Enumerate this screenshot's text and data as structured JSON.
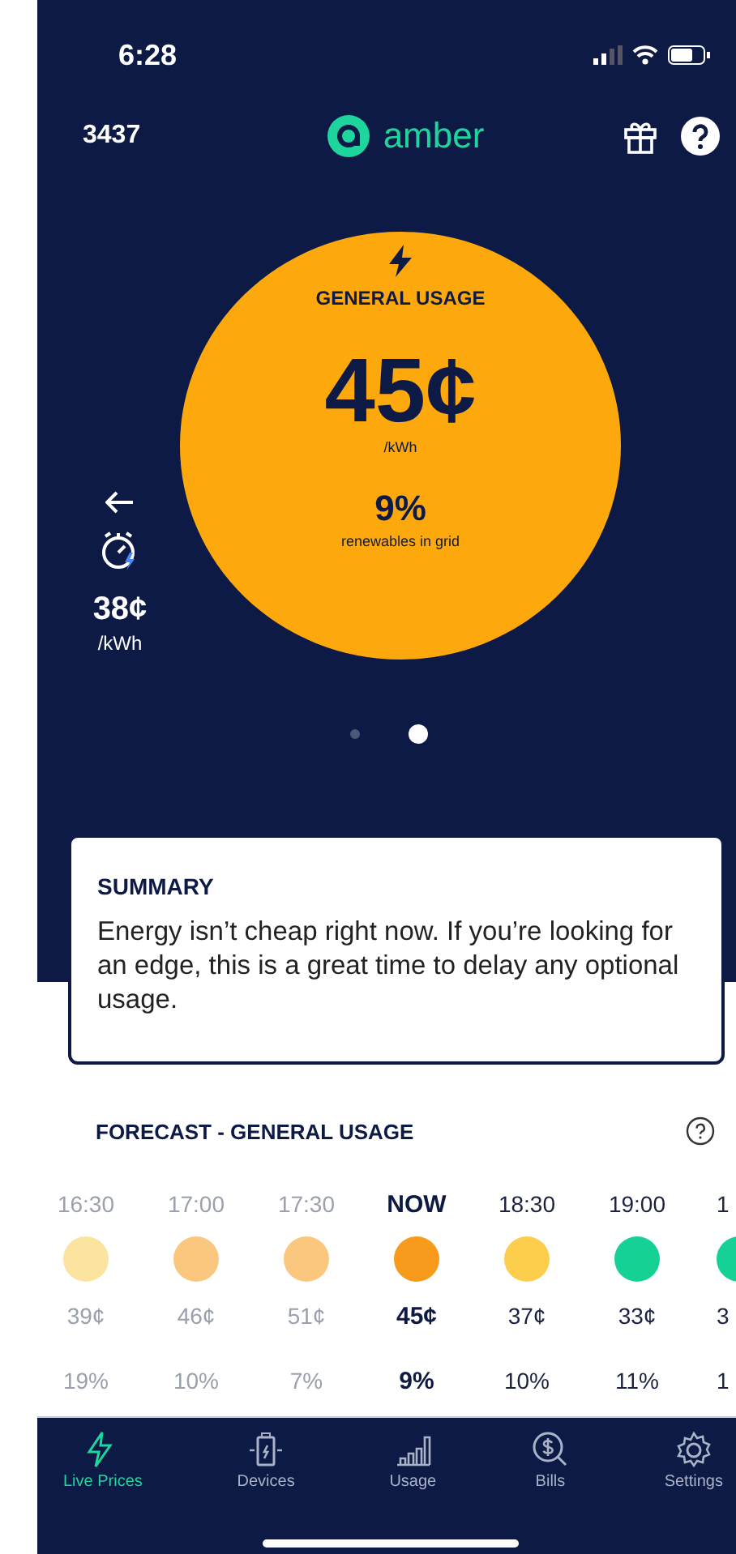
{
  "status_bar": {
    "time": "6:28"
  },
  "header": {
    "account": "3437",
    "logo_text": "amber"
  },
  "price_card": {
    "title": "GENERAL USAGE",
    "price": "45¢",
    "unit": "/kWh",
    "renewables": "9%",
    "renewables_label": "renewables in grid"
  },
  "side_price": {
    "price": "38¢",
    "unit": "/kWh"
  },
  "pager": [
    {
      "selected": false
    },
    {
      "selected": true
    }
  ],
  "summary": {
    "title": "SUMMARY",
    "text": "Energy isn’t cheap right now. If you’re looking for an edge, this is a great time to delay any optional usage."
  },
  "forecast": {
    "title": "FORECAST - GENERAL USAGE",
    "columns": [
      {
        "time": "16:30",
        "price": "39¢",
        "renewables": "19%",
        "color": "#fde3a0",
        "past": true,
        "selected": false
      },
      {
        "time": "17:00",
        "price": "46¢",
        "renewables": "10%",
        "color": "#fbc77f",
        "past": true,
        "selected": false
      },
      {
        "time": "17:30",
        "price": "51¢",
        "renewables": "7%",
        "color": "#fbc77f",
        "past": true,
        "selected": false
      },
      {
        "time": "NOW",
        "price": "45¢",
        "renewables": "9%",
        "color": "#f89a1c",
        "past": false,
        "selected": true
      },
      {
        "time": "18:30",
        "price": "37¢",
        "renewables": "10%",
        "color": "#fdcd4c",
        "past": false,
        "selected": false
      },
      {
        "time": "19:00",
        "price": "33¢",
        "renewables": "11%",
        "color": "#15d195",
        "past": false,
        "selected": false
      },
      {
        "time": "1",
        "price": "3",
        "renewables": "1",
        "color": "#15d195",
        "past": false,
        "selected": false
      }
    ]
  },
  "tabs": [
    {
      "label": "Live Prices",
      "selected": true
    },
    {
      "label": "Devices",
      "selected": false
    },
    {
      "label": "Usage",
      "selected": false
    },
    {
      "label": "Bills",
      "selected": false
    },
    {
      "label": "Settings",
      "selected": false
    }
  ]
}
